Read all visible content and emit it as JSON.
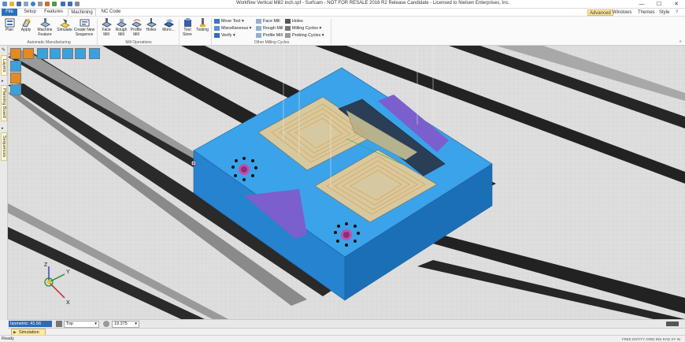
{
  "window": {
    "title": "Workflow Vertical Mill2 inch.spf - Surfcam - NOT FOR RESALE 2016 R2 Release Candidate - Licensed to Nielsen Enterprises, Inc.",
    "minimize": "—",
    "maximize": "☐",
    "close": "✕"
  },
  "tabs": {
    "file": "File",
    "setup": "Setup",
    "features": "Features",
    "machining": "Machining",
    "nc_code": "NC Code"
  },
  "ribbon_right": {
    "advanced": "Advanced",
    "windows": "Windows",
    "themes": "Themes",
    "style": "Style"
  },
  "groups": {
    "automatic_manufacturing": "Automatic Manufacturing",
    "mill_operations": "Mill Operations",
    "other_milling_cycles": "Other Milling Cycles"
  },
  "buttons": {
    "plan": "Plan",
    "apply": "Apply",
    "machine_feature": "Machine Feature",
    "simulate": "Simulate",
    "create_new_sequence": "Create New Sequence",
    "face_mill": "Face Mill",
    "rough_mill": "Rough Mill",
    "profile_mill": "Profile Mill",
    "holes": "Holes",
    "more": "More...",
    "tool_store": "Tool Store",
    "tooling": "Tooling",
    "move_tool": "Move Tool",
    "miscellaneous": "Miscellaneous",
    "verify": "Verify",
    "face_mill_small": "Face Mill",
    "rough_mill_small": "Rough Mill",
    "profile_mill_small": "Profile Mill",
    "holes_small": "Holes",
    "milling_cycles": "Milling Cycles",
    "probing_cycles": "Probing Cycles"
  },
  "sidebar": {
    "layers": "Layers",
    "planning_board": "Planning Board",
    "sequences": "Sequences"
  },
  "statusbar": {
    "iso": "Isometric: 41.56",
    "view": "Top",
    "zoom_value": "19.375"
  },
  "simulation_tab": "Simulation",
  "ready": "Ready",
  "status_right": "FREE ENTITY  GRID  INS  RAD  XY  IN",
  "axes": {
    "x": "X",
    "y": "Y",
    "z": "Z"
  },
  "colors": {
    "part": "#2f93dc",
    "part_top": "#3aa3ea",
    "part_side": "#1a6fb7",
    "part_front": "#2683cf",
    "fixture": "#7b5fcc",
    "toolpath": "#e5983a",
    "accent": "#2a6fb8"
  },
  "icons": {
    "rotate": "rotate-icon",
    "pan": "pan-icon",
    "zoom_fit": "zoom-fit-icon",
    "zoom": "zoom-icon",
    "window": "window-icon",
    "center": "center-icon"
  }
}
